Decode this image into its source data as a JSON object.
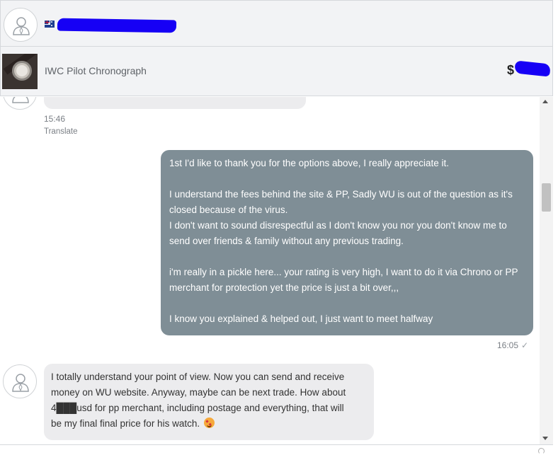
{
  "header": {
    "country_flag": "australia-flag-icon",
    "seller_name": "████████"
  },
  "listing": {
    "title": "IWC Pilot Chronograph",
    "price_prefix": "$",
    "price_value": "████"
  },
  "messages": [
    {
      "id": "msg-prev",
      "direction": "incoming",
      "text": "",
      "time": "15:46",
      "translate_label": "Translate"
    },
    {
      "id": "msg-out",
      "direction": "outgoing",
      "paragraphs": [
        "1st I'd like to thank you for the options above,  I really appreciate it.",
        "I understand the fees behind the site & PP, Sadly WU is out of the question as it's closed because of the virus.\nI don't want to sound disrespectful as I don't know you nor you don't know me to send over friends & family without any previous trading.",
        "i'm really in a pickle here... your rating is very high, I want to do it via Chrono or PP merchant for protection yet the price is just a bit over,,,",
        "I know you explained & helped out, I just want to meet halfway"
      ],
      "time": "16:05",
      "status": "✓"
    },
    {
      "id": "msg-in",
      "direction": "incoming",
      "lines": [
        "I totally understand your point of view. Now you can send and receive",
        "money on WU website. Anyway, maybe can be next trade. How about",
        "4███usd  for pp merchant, including postage and everything, that will",
        "be my final final price for his watch."
      ],
      "emoji": "smiling-face-with-hearts-emoji"
    }
  ],
  "colors": {
    "outgoing_bubble": "#7f8e96",
    "incoming_bubble": "#ececee",
    "header_bg": "#f2f3f5",
    "redaction": "#1600f5"
  }
}
